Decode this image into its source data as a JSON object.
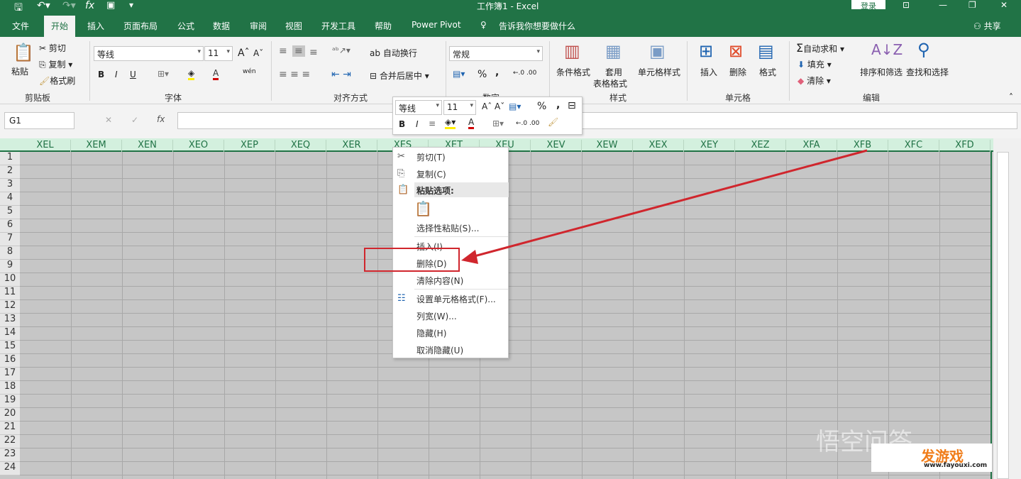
{
  "title": {
    "text": "工作簿1 - Excel",
    "login": "登录",
    "qat": [
      "save-icon",
      "undo-icon",
      "redo-icon",
      "fx-icon",
      "print-preview-icon"
    ]
  },
  "tabs": [
    "文件",
    "开始",
    "插入",
    "页面布局",
    "公式",
    "数据",
    "审阅",
    "视图",
    "开发工具",
    "帮助",
    "Power Pivot"
  ],
  "tell_me": "告诉我你想要做什么",
  "share": "共享",
  "ribbon": {
    "clipboard": {
      "paste": "粘贴",
      "cut": "剪切",
      "copy": "复制",
      "format_painter": "格式刷",
      "label": "剪贴板"
    },
    "font": {
      "name": "等线",
      "size": "11",
      "bold": "B",
      "italic": "I",
      "underline": "U",
      "label": "字体",
      "phonetic": "wén"
    },
    "alignment": {
      "wrap": "自动换行",
      "merge": "合并后居中",
      "label": "对齐方式"
    },
    "number": {
      "format": "常规",
      "percent": "%",
      "comma": ",",
      "label": "数字"
    },
    "styles": {
      "conditional": "条件格式",
      "table1": "套用",
      "table2": "表格格式",
      "cell_styles": "单元格样式",
      "label": "样式"
    },
    "cells": {
      "insert": "插入",
      "delete": "删除",
      "format": "格式",
      "label": "单元格"
    },
    "editing": {
      "autosum": "自动求和",
      "fill": "填充",
      "clear": "清除",
      "sort": "排序和筛选",
      "find": "查找和选择",
      "label": "编辑"
    }
  },
  "formula_bar": {
    "name_box": "G1",
    "fx": "fx",
    "value": ""
  },
  "columns": [
    "XEL",
    "XEM",
    "XEN",
    "XEO",
    "XEP",
    "XEQ",
    "XER",
    "XES",
    "XET",
    "XEU",
    "XEV",
    "XEW",
    "XEX",
    "XEY",
    "XEZ",
    "XFA",
    "XFB",
    "XFC",
    "XFD"
  ],
  "rows": [
    "1",
    "2",
    "3",
    "4",
    "5",
    "6",
    "7",
    "8",
    "9",
    "10",
    "11",
    "12",
    "13",
    "14",
    "15",
    "16",
    "17",
    "18",
    "19",
    "20",
    "21",
    "22",
    "23",
    "24"
  ],
  "mini_toolbar": {
    "font": "等线",
    "size": "11",
    "bold": "B",
    "italic": "I",
    "percent": "%",
    "comma": ","
  },
  "context_menu": [
    {
      "label": "剪切(T)",
      "icon": "scissors-icon"
    },
    {
      "label": "复制(C)",
      "icon": "copy-icon"
    },
    {
      "label": "粘贴选项:",
      "icon": "paste-icon"
    },
    {
      "label": "选择性粘贴(S)..."
    },
    {
      "label": "插入(I)"
    },
    {
      "label": "删除(D)"
    },
    {
      "label": "清除内容(N)"
    },
    {
      "label": "设置单元格格式(F)...",
      "icon": "format-cells-icon"
    },
    {
      "label": "列宽(W)..."
    },
    {
      "label": "隐藏(H)"
    },
    {
      "label": "取消隐藏(U)"
    }
  ],
  "annotation_color": "#d0262d",
  "watermark": {
    "text1": "悟空问答",
    "text2": "发游戏",
    "url": "www.fayouxi.com"
  }
}
